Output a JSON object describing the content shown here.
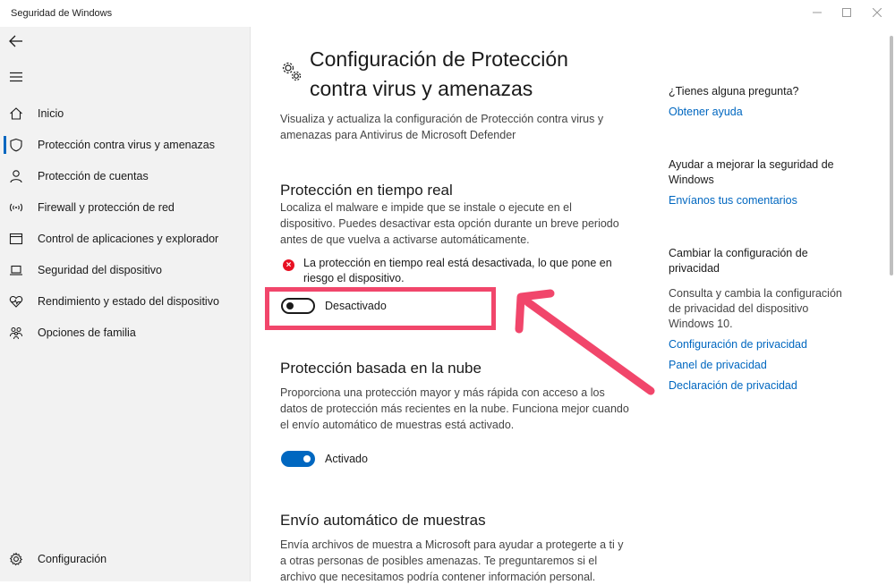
{
  "window": {
    "title": "Seguridad de Windows",
    "minimize_icon": "minimize-icon",
    "maximize_icon": "maximize-icon",
    "close_icon": "close-icon"
  },
  "sidebar": {
    "items": [
      {
        "label": "Inicio",
        "icon": "home-icon"
      },
      {
        "label": "Protección contra virus y amenazas",
        "icon": "shield-icon",
        "active": true
      },
      {
        "label": "Protección de cuentas",
        "icon": "person-icon"
      },
      {
        "label": "Firewall y protección de red",
        "icon": "wifi-icon"
      },
      {
        "label": "Control de aplicaciones y explorador",
        "icon": "browser-icon"
      },
      {
        "label": "Seguridad del dispositivo",
        "icon": "laptop-icon"
      },
      {
        "label": "Rendimiento y estado del dispositivo",
        "icon": "heart-icon"
      },
      {
        "label": "Opciones de familia",
        "icon": "family-icon"
      }
    ],
    "settings_label": "Configuración"
  },
  "main": {
    "title_line1": "Configuración de Protección",
    "title_line2": "contra virus y amenazas",
    "description": "Visualiza y actualiza la configuración de Protección contra virus y amenazas para Antivirus de Microsoft Defender",
    "realtime": {
      "title": "Protección en tiempo real",
      "description": "Localiza el malware e impide que se instale o ejecute en el dispositivo. Puedes desactivar esta opción durante un breve periodo antes de que vuelva a activarse automáticamente.",
      "warning": "La protección en tiempo real está desactivada, lo que pone en riesgo el dispositivo.",
      "toggle_label": "Desactivado",
      "toggle_on": false
    },
    "cloud": {
      "title": "Protección basada en la nube",
      "description": "Proporciona una protección mayor y más rápida con acceso a los datos de protección más recientes en la nube. Funciona mejor cuando el envío automático de muestras está activado.",
      "toggle_label": "Activado",
      "toggle_on": true
    },
    "samples": {
      "title": "Envío automático de muestras",
      "description": "Envía archivos de muestra a Microsoft para ayudar a protegerte a ti y a otras personas de posibles amenazas. Te preguntaremos si el archivo que necesitamos podría contener información personal."
    }
  },
  "right": {
    "question": "¿Tienes alguna pregunta?",
    "help_link": "Obtener ayuda",
    "improve": "Ayudar a mejorar la seguridad de Windows",
    "feedback_link": "Envíanos tus comentarios",
    "privacy_title": "Cambiar la configuración de privacidad",
    "privacy_desc": "Consulta y cambia la configuración de privacidad del dispositivo Windows 10.",
    "privacy_links": [
      "Configuración de privacidad",
      "Panel de privacidad",
      "Declaración de privacidad"
    ]
  },
  "annotation": {
    "color": "#f1466b"
  },
  "colors": {
    "accent": "#0067c0",
    "error": "#e81123"
  }
}
